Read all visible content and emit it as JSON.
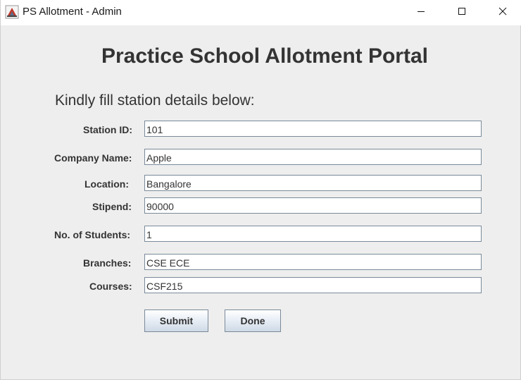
{
  "window": {
    "title": "PS Allotment - Admin",
    "icon": "java-app-icon",
    "controls": [
      "minimize-icon",
      "maximize-icon",
      "close-icon"
    ]
  },
  "main": {
    "heading": "Practice School Allotment Portal",
    "subheading": "Kindly fill station details below:"
  },
  "form": {
    "station_id": {
      "label": "Station ID:",
      "value": "101"
    },
    "company_name": {
      "label": "Company Name:",
      "value": "Apple"
    },
    "location": {
      "label": "Location:",
      "value": "Bangalore"
    },
    "stipend": {
      "label": "Stipend:",
      "value": "90000"
    },
    "num_students": {
      "label": "No. of Students:",
      "value": "1"
    },
    "branches": {
      "label": "Branches:",
      "value": "CSE ECE"
    },
    "courses": {
      "label": "Courses:",
      "value": "CSF215"
    }
  },
  "buttons": {
    "submit": "Submit",
    "done": "Done"
  },
  "colors": {
    "window_bg": "#eeeeee",
    "titlebar_bg": "#ffffff",
    "text": "#333333",
    "field_border": "#7a8a99",
    "button_gradient_bottom": "#cfdae6"
  }
}
